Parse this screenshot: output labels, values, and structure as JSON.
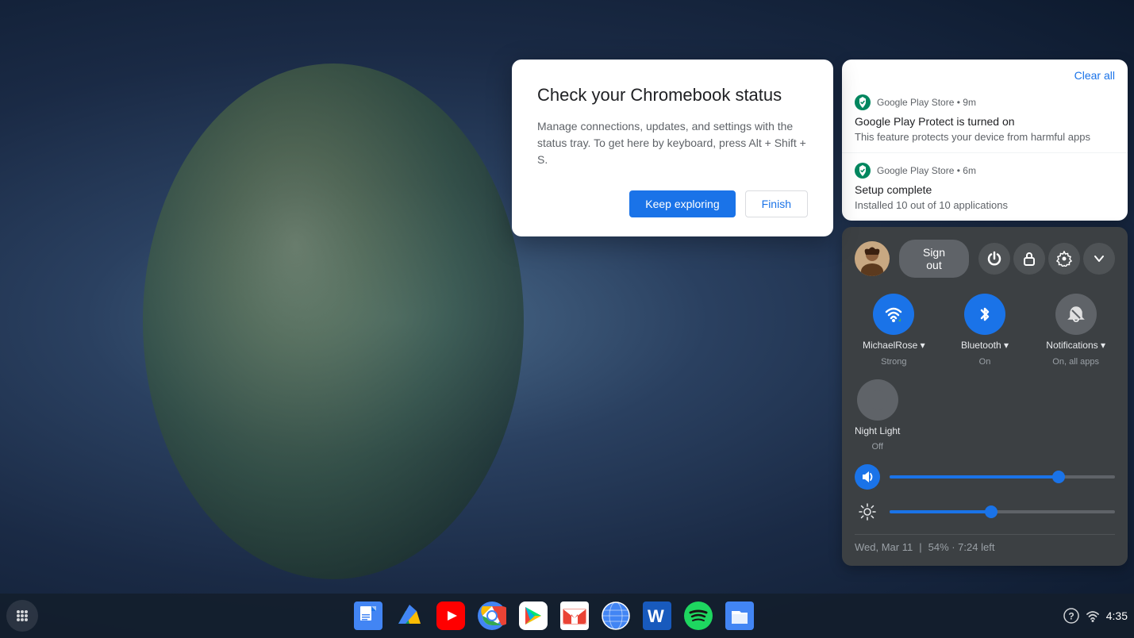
{
  "desktop": {
    "background": "blue-dark"
  },
  "dialog": {
    "title": "Check your Chromebook status",
    "body": "Manage connections, updates, and settings with the status tray. To get here by keyboard, press Alt + Shift + S.",
    "btn_keep_exploring": "Keep exploring",
    "btn_finish": "Finish"
  },
  "notifications": {
    "clear_all": "Clear all",
    "items": [
      {
        "source": "Google Play Store",
        "time": "9m",
        "title": "Google Play Protect is turned on",
        "desc": "This feature protects your device from harmful apps"
      },
      {
        "source": "Google Play Store",
        "time": "6m",
        "title": "Setup complete",
        "desc": "Installed 10 out of 10 applications"
      }
    ]
  },
  "system_panel": {
    "sign_out": "Sign out",
    "user_initial": "🧑",
    "toggles": [
      {
        "label": "MichaelRose",
        "sublabel": "Strong",
        "state": "active",
        "has_arrow": true
      },
      {
        "label": "Bluetooth",
        "sublabel": "On",
        "state": "active",
        "has_arrow": true
      },
      {
        "label": "Notifications",
        "sublabel": "On, all apps",
        "state": "inactive",
        "has_arrow": true
      }
    ],
    "night_light": {
      "label": "Night Light",
      "sublabel": "Off",
      "state": "inactive"
    },
    "volume_pct": 75,
    "brightness_pct": 45,
    "status": {
      "date": "Wed, Mar 11",
      "battery": "54% · 7:24 left"
    }
  },
  "taskbar": {
    "time": "4:35",
    "apps": [
      {
        "name": "Google Docs",
        "id": "docs"
      },
      {
        "name": "Google Drive",
        "id": "drive"
      },
      {
        "name": "YouTube",
        "id": "youtube"
      },
      {
        "name": "Google Chrome",
        "id": "chrome"
      },
      {
        "name": "Google Play Store",
        "id": "play"
      },
      {
        "name": "Gmail",
        "id": "gmail"
      },
      {
        "name": "Earth",
        "id": "earth"
      },
      {
        "name": "Microsoft Word",
        "id": "word"
      },
      {
        "name": "Spotify",
        "id": "spotify"
      },
      {
        "name": "Files",
        "id": "files"
      }
    ]
  }
}
